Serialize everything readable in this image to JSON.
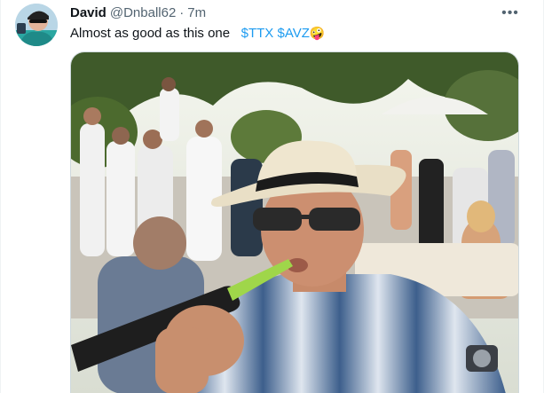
{
  "tweet": {
    "author_name": "David",
    "handle": "@Dnball62",
    "separator": "·",
    "time": "7m",
    "text": "Almost as good as this one",
    "cashtags": [
      "$TTX",
      "$AVZ"
    ],
    "emoji": "🤪",
    "more_icon": "ellipsis-icon"
  },
  "colors": {
    "cashtag": "#1d9bf0",
    "text": "#0f1419",
    "secondary": "#536471"
  }
}
